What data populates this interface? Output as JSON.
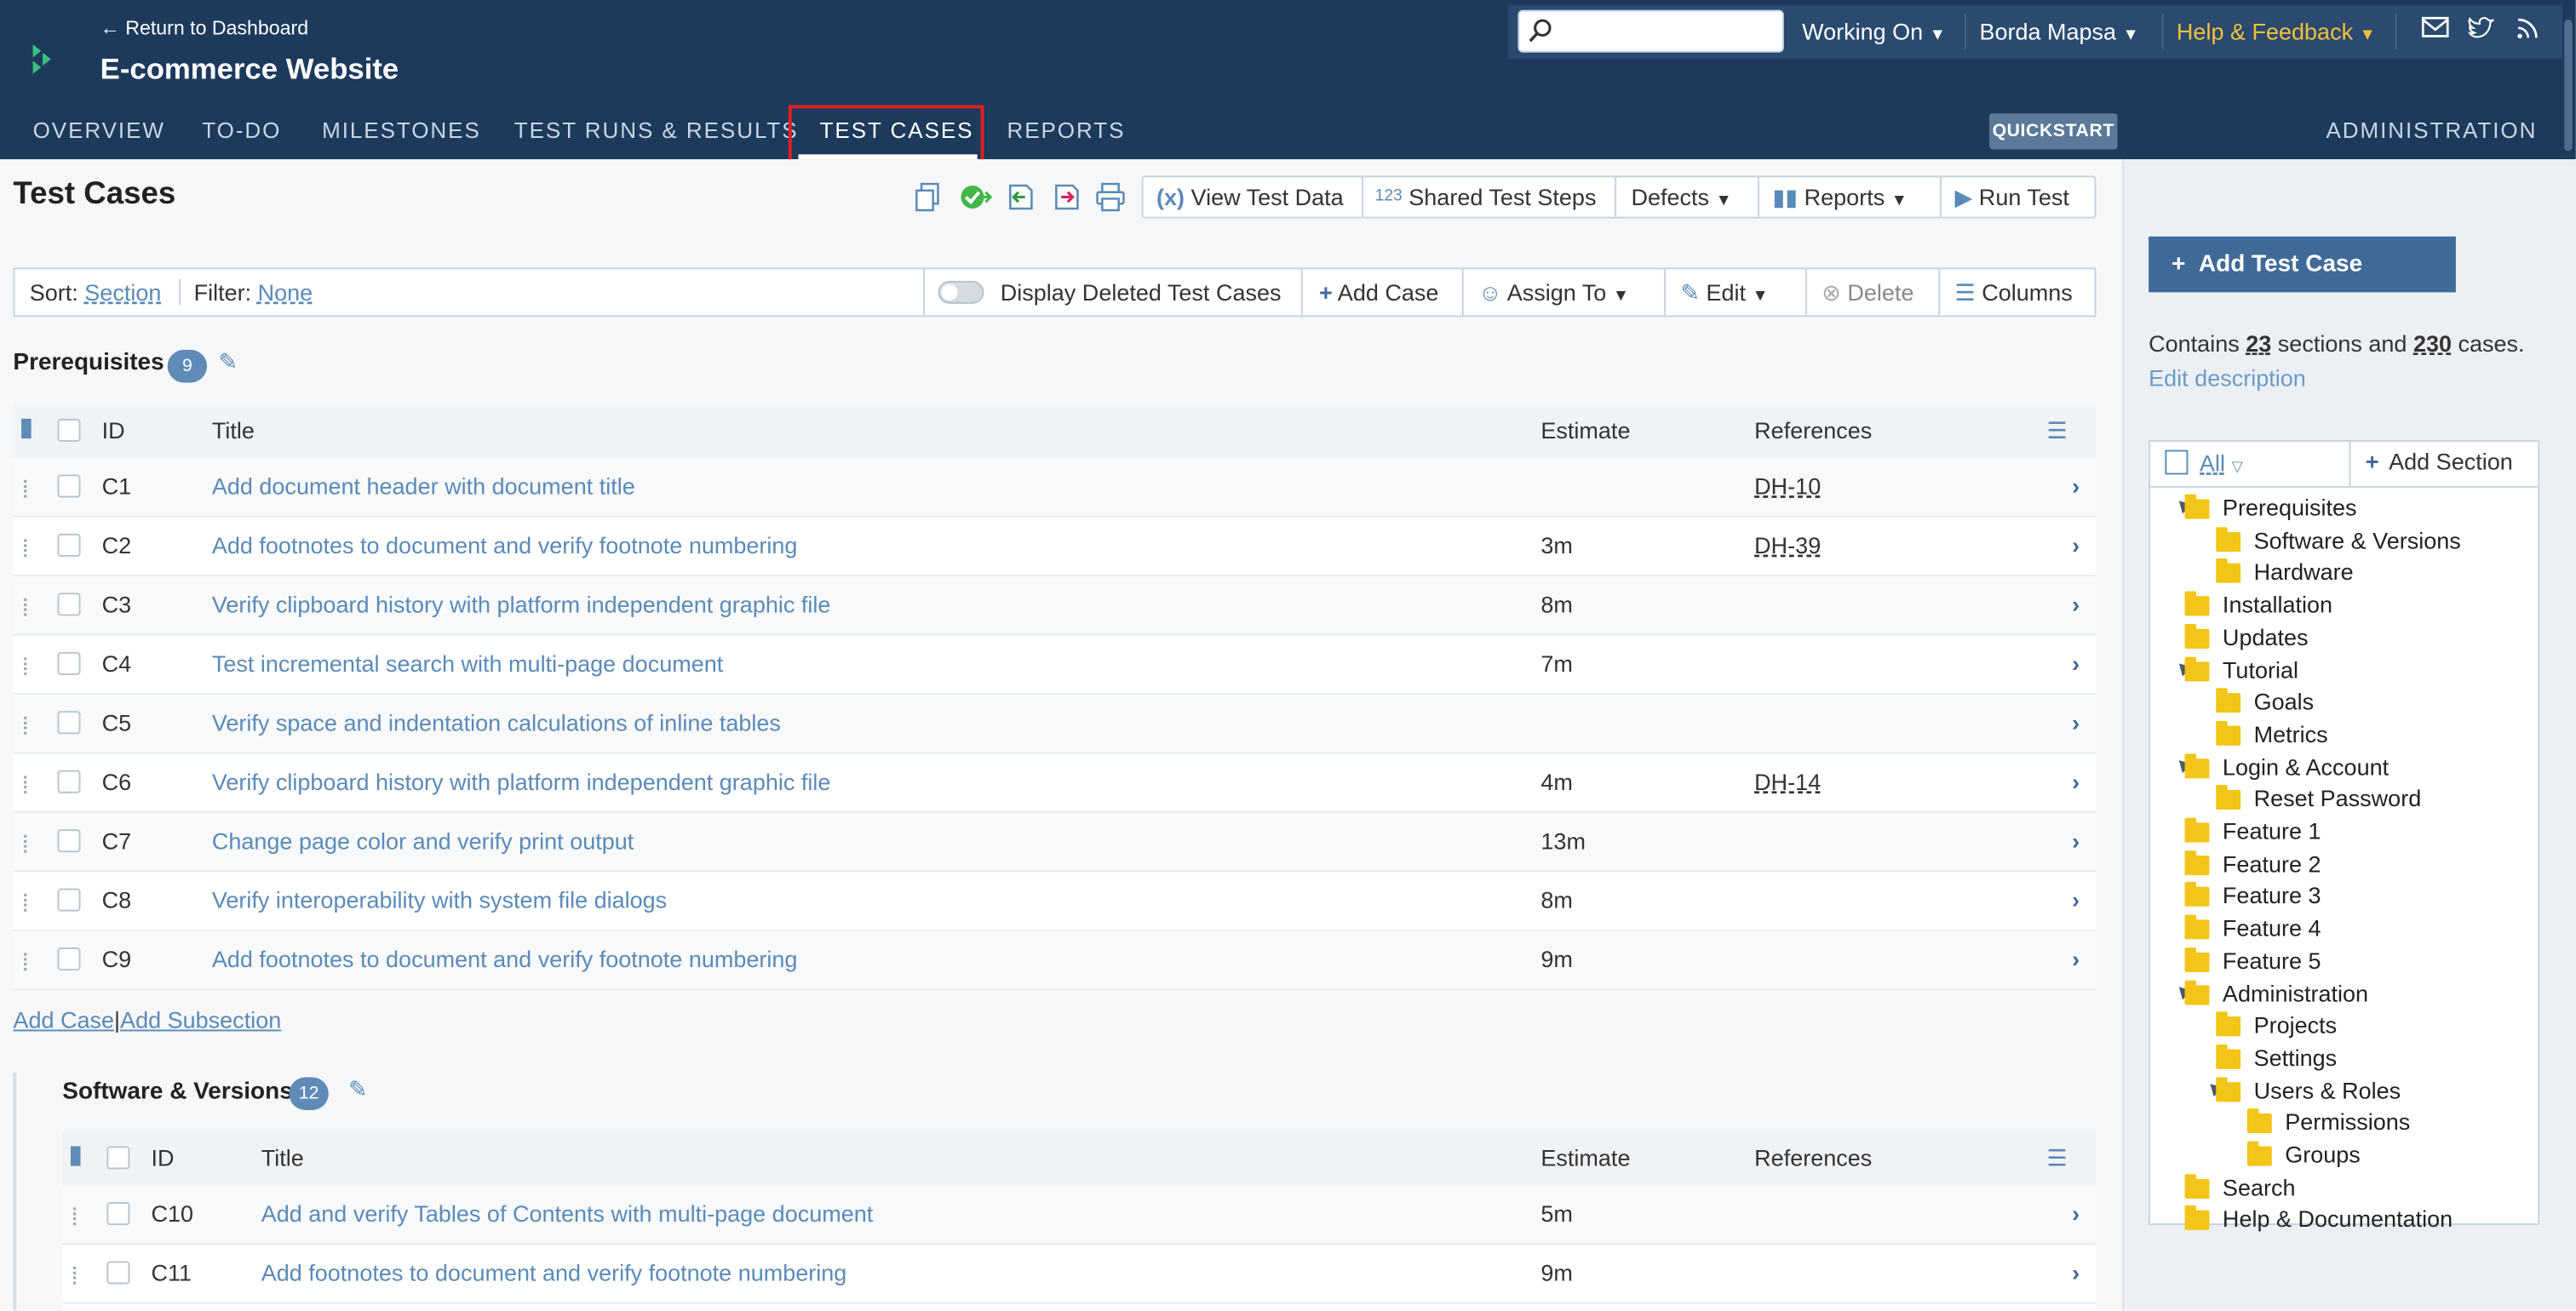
{
  "header": {
    "back_link": "← Return to Dashboard",
    "project_title": "E-commerce Website",
    "search_placeholder": "",
    "working_on": "Working On",
    "user": "Borda Mapsa",
    "help": "Help & Feedback",
    "quickstart": "QUICKSTART",
    "administration": "ADMINISTRATION"
  },
  "nav": {
    "items": [
      "OVERVIEW",
      "TO-DO",
      "MILESTONES",
      "TEST RUNS & RESULTS",
      "TEST CASES",
      "REPORTS"
    ],
    "active": "TEST CASES"
  },
  "page": {
    "title": "Test Cases",
    "toolbar": {
      "view_test_data": "View Test Data",
      "shared_test_steps": "Shared Test Steps",
      "defects": "Defects",
      "reports": "Reports",
      "run_test": "Run Test"
    },
    "filterbar": {
      "sort_label": "Sort:",
      "sort_value": "Section",
      "filter_label": "Filter:",
      "filter_value": "None",
      "display_deleted": "Display Deleted Test Cases",
      "add_case": "Add Case",
      "assign_to": "Assign To",
      "edit": "Edit",
      "delete": "Delete",
      "columns": "Columns"
    }
  },
  "columns": {
    "id": "ID",
    "title": "Title",
    "estimate": "Estimate",
    "references": "References"
  },
  "sections": [
    {
      "name": "Prerequisites",
      "count": "9",
      "rows": [
        {
          "id": "C1",
          "title": "Add document header with document title",
          "estimate": "",
          "ref": "DH-10"
        },
        {
          "id": "C2",
          "title": "Add footnotes to document and verify footnote numbering",
          "estimate": "3m",
          "ref": "DH-39"
        },
        {
          "id": "C3",
          "title": "Verify clipboard history with platform independent graphic file",
          "estimate": "8m",
          "ref": ""
        },
        {
          "id": "C4",
          "title": "Test incremental search with multi-page document",
          "estimate": "7m",
          "ref": ""
        },
        {
          "id": "C5",
          "title": "Verify space and indentation calculations of inline tables",
          "estimate": "",
          "ref": ""
        },
        {
          "id": "C6",
          "title": "Verify clipboard history with platform independent graphic file",
          "estimate": "4m",
          "ref": "DH-14"
        },
        {
          "id": "C7",
          "title": "Change page color and verify print output",
          "estimate": "13m",
          "ref": ""
        },
        {
          "id": "C8",
          "title": "Verify interoperability with system file dialogs",
          "estimate": "8m",
          "ref": ""
        },
        {
          "id": "C9",
          "title": "Add footnotes to document and verify footnote numbering",
          "estimate": "9m",
          "ref": ""
        }
      ],
      "add_case": "Add Case",
      "separator": "|",
      "add_subsection": "Add Subsection"
    },
    {
      "name": "Software & Versions",
      "count": "12",
      "rows": [
        {
          "id": "C10",
          "title": "Add and verify Tables of Contents with multi-page document",
          "estimate": "5m",
          "ref": ""
        },
        {
          "id": "C11",
          "title": "Add footnotes to document and verify footnote numbering",
          "estimate": "9m",
          "ref": ""
        }
      ]
    }
  ],
  "sidebar": {
    "add_test_case": "Add Test Case",
    "summary_prefix": "Contains",
    "sections_count": "23",
    "summary_mid": "sections and",
    "cases_count": "230",
    "summary_suffix": "cases.",
    "edit_description": "Edit description",
    "tree_filter": "All",
    "add_section": "Add Section",
    "tree": [
      {
        "label": "Prerequisites",
        "level": 0,
        "expanded": true
      },
      {
        "label": "Software & Versions",
        "level": 1
      },
      {
        "label": "Hardware",
        "level": 1
      },
      {
        "label": "Installation",
        "level": 0
      },
      {
        "label": "Updates",
        "level": 0
      },
      {
        "label": "Tutorial",
        "level": 0,
        "expanded": true
      },
      {
        "label": "Goals",
        "level": 1
      },
      {
        "label": "Metrics",
        "level": 1
      },
      {
        "label": "Login & Account",
        "level": 0,
        "expanded": true
      },
      {
        "label": "Reset Password",
        "level": 1
      },
      {
        "label": "Feature 1",
        "level": 0
      },
      {
        "label": "Feature 2",
        "level": 0
      },
      {
        "label": "Feature 3",
        "level": 0
      },
      {
        "label": "Feature 4",
        "level": 0
      },
      {
        "label": "Feature 5",
        "level": 0
      },
      {
        "label": "Administration",
        "level": 0,
        "expanded": true
      },
      {
        "label": "Projects",
        "level": 1
      },
      {
        "label": "Settings",
        "level": 1
      },
      {
        "label": "Users & Roles",
        "level": 1,
        "expanded": true
      },
      {
        "label": "Permissions",
        "level": 2
      },
      {
        "label": "Groups",
        "level": 2
      },
      {
        "label": "Search",
        "level": 0
      },
      {
        "label": "Help & Documentation",
        "level": 0
      }
    ]
  },
  "colors": {
    "header_bg": "#1d3a5c",
    "link": "#5a8ab8",
    "accent_button": "#3f6a98",
    "badge": "#5f8bb6",
    "folder": "#f2c518",
    "highlight": "#e02020"
  }
}
